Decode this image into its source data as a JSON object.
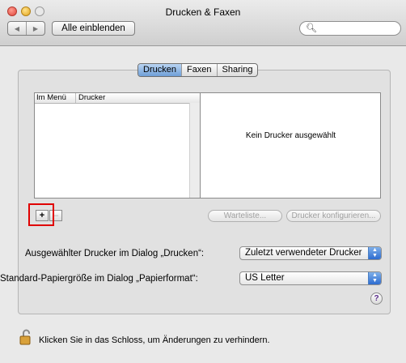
{
  "window": {
    "title": "Drucken & Faxen"
  },
  "toolbar": {
    "show_all": "Alle einblenden",
    "back_icon": "back-arrow-icon",
    "forward_icon": "forward-arrow-icon",
    "search_icon": "search-icon"
  },
  "tabs": [
    {
      "label": "Drucken",
      "active": true
    },
    {
      "label": "Faxen",
      "active": false
    },
    {
      "label": "Sharing",
      "active": false
    }
  ],
  "printer_list": {
    "columns": [
      "Im Menü",
      "Drucker"
    ],
    "rows": []
  },
  "detail": {
    "message": "Kein Drucker ausgewählt"
  },
  "buttons": {
    "add": "+",
    "remove": "–",
    "queue": "Warteliste...",
    "configure": "Drucker konfigurieren..."
  },
  "settings": {
    "printer_label": "Ausgewählter Drucker im Dialog „Drucken“:",
    "printer_value": "Zuletzt verwendeter Drucker",
    "paper_label": "Standard-Papiergröße im Dialog „Papierformat“:",
    "paper_value": "US Letter"
  },
  "help": "?",
  "lock": {
    "text": "Klicken Sie in das Schloss, um Änderungen zu verhindern.",
    "icon": "lock-icon"
  },
  "colors": {
    "highlight": "#e00000",
    "accent": "#3a78d6"
  }
}
